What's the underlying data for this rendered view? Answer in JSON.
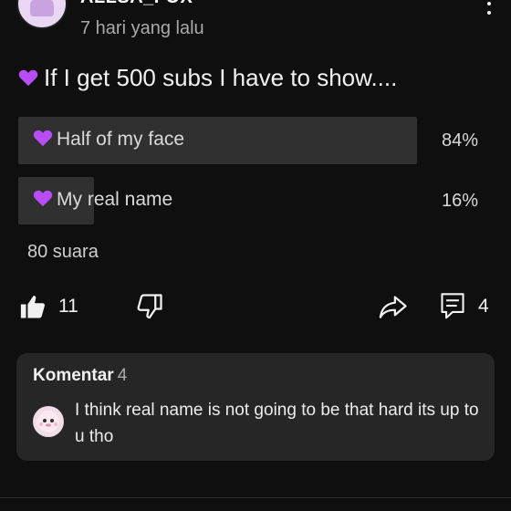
{
  "header": {
    "channel_name": "ALLSA_FOX",
    "time": "7 hari yang lalu"
  },
  "post": {
    "title": "If I get 500 subs I have to show...."
  },
  "poll": {
    "options": [
      {
        "label": "Half of my face",
        "percent_label": "84%",
        "percent": 84
      },
      {
        "label": "My real name",
        "percent_label": "16%",
        "percent": 16
      }
    ],
    "votes": "80 suara"
  },
  "actions": {
    "likes": "11",
    "comments": "4"
  },
  "comments": {
    "title": "Komentar",
    "count": "4",
    "top_comment": "I think real name is not going to be that hard its up to u tho"
  },
  "icons": [
    "avatar",
    "kebab-menu-icon",
    "purple-heart-icon",
    "like-icon",
    "dislike-icon",
    "share-icon",
    "comment-icon"
  ],
  "colors": {
    "background": "#0f0f0f",
    "poll_fill": "#303030",
    "card": "#262626",
    "heart": "#b84df5"
  }
}
